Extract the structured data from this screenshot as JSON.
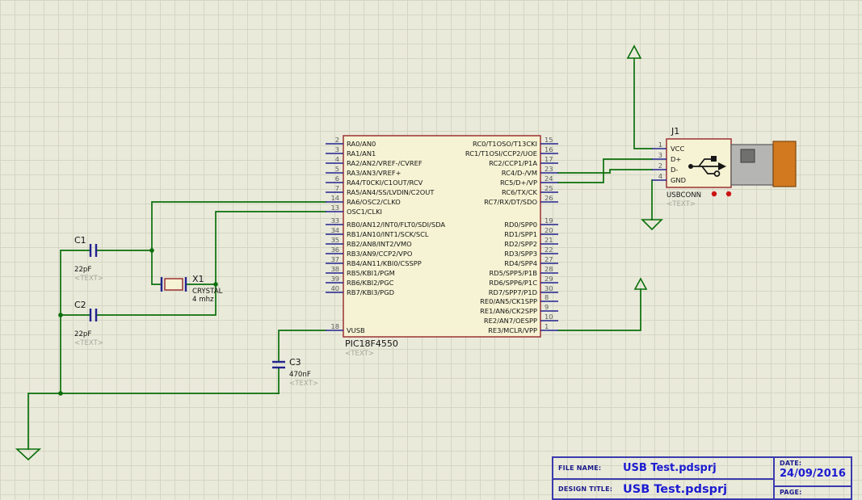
{
  "colors": {
    "wire": "#0b6f0b",
    "pin": "#23238f",
    "comp_border": "#9c3232",
    "comp_fill": "#f6f3d4",
    "ghost_text": "#a8a89a",
    "marker_red": "#cc1414",
    "usb_metal": "#b5b5b3",
    "usb_orange": "#d2781e",
    "tb_border": "#3a3aae",
    "tb_label": "#1a1a8c",
    "tb_value": "#1b1bd1"
  },
  "chip": {
    "ref": "PIC18F4550",
    "note": "<TEXT>",
    "left_pin_groups": [
      [
        {
          "num": "2",
          "name": "RA0/AN0"
        },
        {
          "num": "3",
          "name": "RA1/AN1"
        },
        {
          "num": "4",
          "name": "RA2/AN2/VREF-/CVREF"
        },
        {
          "num": "5",
          "name": "RA3/AN3/VREF+"
        },
        {
          "num": "6",
          "name": "RA4/T0CKI/C1OUT/RCV"
        },
        {
          "num": "7",
          "name": "RA5/AN4/SS/LVDIN/C2OUT"
        },
        {
          "num": "14",
          "name": "RA6/OSC2/CLKO"
        },
        {
          "num": "13",
          "name": "OSC1/CLKI"
        }
      ],
      [
        {
          "num": "33",
          "name": "RB0/AN12/INT0/FLT0/SDI/SDA"
        },
        {
          "num": "34",
          "name": "RB1/AN10/INT1/SCK/SCL"
        },
        {
          "num": "35",
          "name": "RB2/AN8/INT2/VMO"
        },
        {
          "num": "36",
          "name": "RB3/AN9/CCP2/VPO"
        },
        {
          "num": "37",
          "name": "RB4/AN11/KBI0/CSSPP"
        },
        {
          "num": "38",
          "name": "RB5/KBI1/PGM"
        },
        {
          "num": "39",
          "name": "RB6/KBI2/PGC"
        },
        {
          "num": "40",
          "name": "RB7/KBI3/PGD"
        }
      ],
      [
        {
          "num": "18",
          "name": "VUSB"
        }
      ]
    ],
    "right_pin_groups": [
      [
        {
          "num": "15",
          "name": "RC0/T1OSO/T13CKI"
        },
        {
          "num": "16",
          "name": "RC1/T1OSI/CCP2/UOE"
        },
        {
          "num": "17",
          "name": "RC2/CCP1/P1A"
        },
        {
          "num": "23",
          "name": "RC4/D-/VM"
        },
        {
          "num": "24",
          "name": "RC5/D+/VP"
        },
        {
          "num": "25",
          "name": "RC6/TX/CK"
        },
        {
          "num": "26",
          "name": "RC7/RX/DT/SDO"
        }
      ],
      [
        {
          "num": "19",
          "name": "RD0/SPP0"
        },
        {
          "num": "20",
          "name": "RD1/SPP1"
        },
        {
          "num": "21",
          "name": "RD2/SPP2"
        },
        {
          "num": "22",
          "name": "RD3/SPP3"
        },
        {
          "num": "27",
          "name": "RD4/SPP4"
        },
        {
          "num": "28",
          "name": "RD5/SPP5/P1B"
        },
        {
          "num": "29",
          "name": "RD6/SPP6/P1C"
        },
        {
          "num": "30",
          "name": "RD7/SPP7/P1D"
        }
      ],
      [
        {
          "num": "8",
          "name": "RE0/AN5/CK1SPP"
        },
        {
          "num": "9",
          "name": "RE1/AN6/CK2SPP"
        },
        {
          "num": "10",
          "name": "RE2/AN7/OESPP"
        },
        {
          "num": "1",
          "name": "RE3/MCLR/VPP"
        }
      ]
    ]
  },
  "c1": {
    "ref": "C1",
    "value": "22pF",
    "note": "<TEXT>"
  },
  "c2": {
    "ref": "C2",
    "value": "22pF",
    "note": "<TEXT>"
  },
  "c3": {
    "ref": "C3",
    "value": "470nF",
    "note": "<TEXT>"
  },
  "x1": {
    "ref": "X1",
    "value": "CRYSTAL",
    "freq": "4 mhz"
  },
  "j1": {
    "ref": "J1",
    "name": "USBCONN",
    "note": "<TEXT>",
    "pins": [
      {
        "num": "1",
        "name": "VCC"
      },
      {
        "num": "3",
        "name": "D+"
      },
      {
        "num": "2",
        "name": "D-"
      },
      {
        "num": "4",
        "name": "GND"
      }
    ]
  },
  "title_block": {
    "file_name_label": "FILE NAME:",
    "file_name": "USB Test.pdsprj",
    "design_title_label": "DESIGN TITLE:",
    "design_title": "USB Test.pdsprj",
    "date_label": "DATE:",
    "date": "24/09/2016",
    "page_label": "PAGE:"
  }
}
